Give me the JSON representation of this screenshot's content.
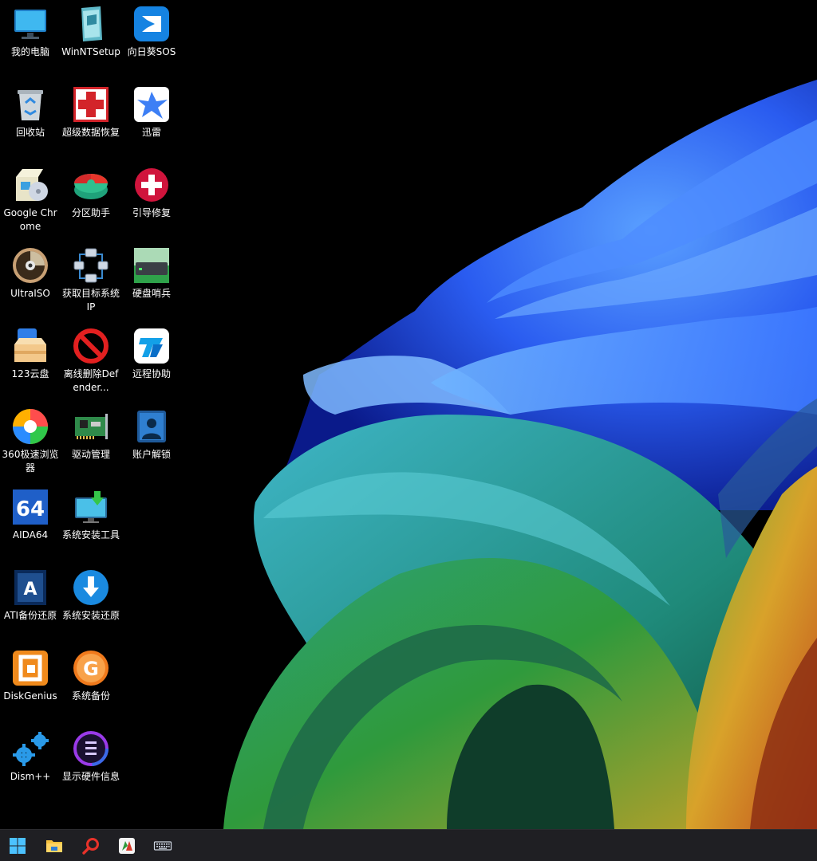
{
  "desktop": {
    "icons": [
      {
        "label": "我的电脑",
        "icon": "computer-icon"
      },
      {
        "label": "WinNTSetup",
        "icon": "winntsetup-icon"
      },
      {
        "label": "向日葵SOS",
        "icon": "sunlogin-icon"
      },
      {
        "label": "回收站",
        "icon": "recycle-bin-icon"
      },
      {
        "label": "超级数据恢复",
        "icon": "data-recovery-icon"
      },
      {
        "label": "迅雷",
        "icon": "thunder-icon"
      },
      {
        "label": "Google Chrome",
        "icon": "installer-box-icon"
      },
      {
        "label": "分区助手",
        "icon": "partition-icon"
      },
      {
        "label": "引导修复",
        "icon": "boot-repair-icon"
      },
      {
        "label": "UltraISO",
        "icon": "disc-icon"
      },
      {
        "label": "获取目标系统IP",
        "icon": "network-icon"
      },
      {
        "label": "硬盘哨兵",
        "icon": "hard-disk-icon"
      },
      {
        "label": "123云盘",
        "icon": "cloud-box-icon"
      },
      {
        "label": "离线删除Defender...",
        "icon": "prohibited-icon"
      },
      {
        "label": "远程协助",
        "icon": "remote-assist-icon"
      },
      {
        "label": "360极速浏览器",
        "icon": "browser-360-icon"
      },
      {
        "label": "驱动管理",
        "icon": "circuit-board-icon"
      },
      {
        "label": "账户解锁",
        "icon": "account-icon"
      },
      {
        "label": "AIDA64",
        "icon": "aida64-icon"
      },
      {
        "label": "系统安装工具",
        "icon": "monitor-install-icon"
      },
      {
        "label": "ATI备份还原",
        "icon": "acronis-icon"
      },
      {
        "label": "系统安装还原",
        "icon": "download-circle-icon"
      },
      {
        "label": "DiskGenius",
        "icon": "diskgenius-icon"
      },
      {
        "label": "系统备份",
        "icon": "ghost-backup-icon"
      },
      {
        "label": "Dism++",
        "icon": "gears-icon"
      },
      {
        "label": "显示硬件信息",
        "icon": "hardware-info-icon"
      }
    ]
  },
  "taskbar": {
    "items": [
      {
        "icon": "windows-start-icon"
      },
      {
        "icon": "file-explorer-icon"
      },
      {
        "icon": "search-icon"
      },
      {
        "icon": "app-pinned-icon"
      },
      {
        "icon": "keyboard-icon"
      }
    ]
  },
  "colors": {
    "desktop_background": "#000000",
    "taskbar": "#202024",
    "wallpaper_blue": "#2f6bff",
    "wallpaper_teal": "#2aa7a0"
  }
}
